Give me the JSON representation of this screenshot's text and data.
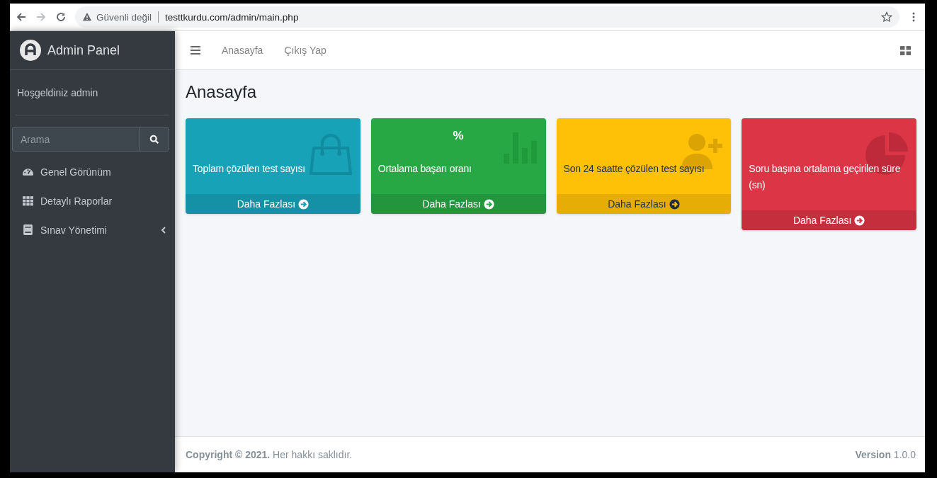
{
  "browser": {
    "security_label": "Güvenli değil",
    "url": "testtkurdu.com/admin/main.php"
  },
  "brand": {
    "title": "Admin Panel"
  },
  "navbar": {
    "links": [
      "Anasayfa",
      "Çıkış Yap"
    ]
  },
  "sidebar": {
    "user": "Hoşgeldiniz admin",
    "search": {
      "placeholder": "Arama"
    },
    "items": [
      {
        "label": "Genel Görünüm",
        "kind": "gauge",
        "has_submenu": false
      },
      {
        "label": "Detaylı Raporlar",
        "kind": "grid",
        "has_submenu": false
      },
      {
        "label": "Sınav Yönetimi",
        "kind": "book",
        "has_submenu": true
      }
    ]
  },
  "page_title": "Anasayfa",
  "cards": [
    {
      "kind": "info",
      "label": "Toplam çözülen test sayısı",
      "link": "Daha Fazlası"
    },
    {
      "kind": "success",
      "value": "%",
      "label": "Ortalama başarı oranı",
      "link": "Daha Fazlası"
    },
    {
      "kind": "warning",
      "label": "Son 24 saatte çözülen test sayısı",
      "link": "Daha Fazlası"
    },
    {
      "kind": "danger",
      "label": "Soru başına ortalama geçirilen süre (sn)",
      "link": "Daha Fazlası"
    }
  ],
  "footer": {
    "copyright": "**Copyright © 2021.** Her hakkı saklıdır.",
    "version": "**Version** 1.0.0"
  }
}
